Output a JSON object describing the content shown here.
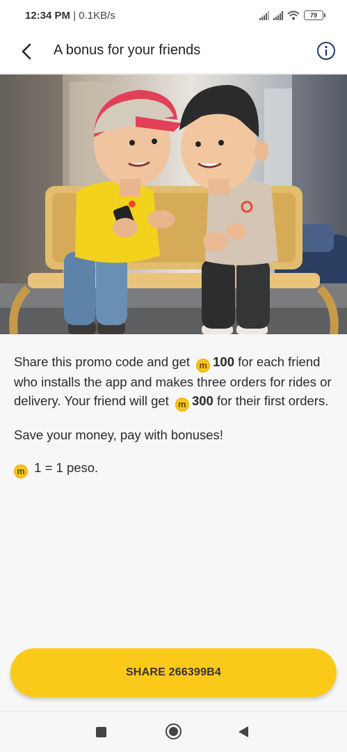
{
  "status_bar": {
    "time": "12:34 PM",
    "network_speed": "| 0.1KB/s",
    "battery": "79"
  },
  "header": {
    "title": "A bonus for your friends",
    "back_icon": "chevron-left-icon",
    "info_icon": "info-icon"
  },
  "hero": {
    "icon": "two-cartoon-characters-on-bench-illustration"
  },
  "content": {
    "p1_a": "Share this promo code and get",
    "p1_amount1": "100",
    "p1_b": "for each friend who installs the app and makes three orders for rides or delivery. Your friend will get",
    "p1_amount2": "300",
    "p1_c": "for their first orders.",
    "p2": "Save your money, pay with bonuses!",
    "rate": "1 = 1 peso.",
    "coin_symbol": "m",
    "coin_color": "#f6c624"
  },
  "share_button": {
    "label": "SHARE 266399B4",
    "color": "#fbc919"
  },
  "nav": {
    "recents_icon": "square-icon",
    "home_icon": "circle-icon",
    "back_icon": "triangle-back-icon"
  }
}
